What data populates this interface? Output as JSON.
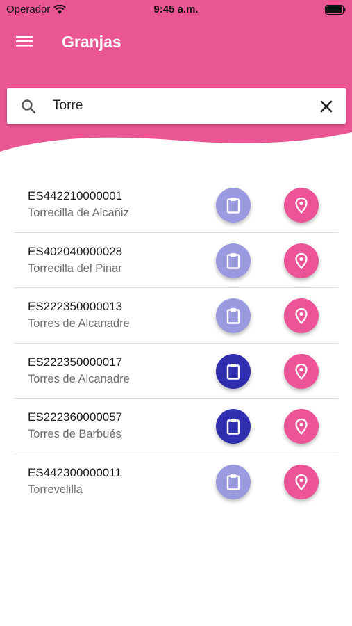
{
  "status_bar": {
    "carrier": "Operador",
    "time": "9:45 a.m."
  },
  "app_bar": {
    "title": "Granjas",
    "menu_icon": "hamburger-menu-icon"
  },
  "search": {
    "value": "Torre",
    "icon": "search-icon",
    "clear_icon": "close-icon"
  },
  "colors": {
    "header": "#ea5594",
    "clipboard_light": "#9a9ae0",
    "clipboard_dark": "#2e2eae",
    "location": "#ec5497"
  },
  "farms": [
    {
      "code": "ES442210000001",
      "name": "Torrecilla de Alcañiz",
      "clipboard_active": false
    },
    {
      "code": "ES402040000028",
      "name": "Torrecilla del Pinar",
      "clipboard_active": false
    },
    {
      "code": "ES222350000013",
      "name": "Torres de Alcanadre",
      "clipboard_active": false
    },
    {
      "code": "ES222350000017",
      "name": "Torres de Alcanadre",
      "clipboard_active": true
    },
    {
      "code": "ES222360000057",
      "name": "Torres de Barbués",
      "clipboard_active": true
    },
    {
      "code": "ES442300000011",
      "name": "Torrevelilla",
      "clipboard_active": false
    }
  ]
}
